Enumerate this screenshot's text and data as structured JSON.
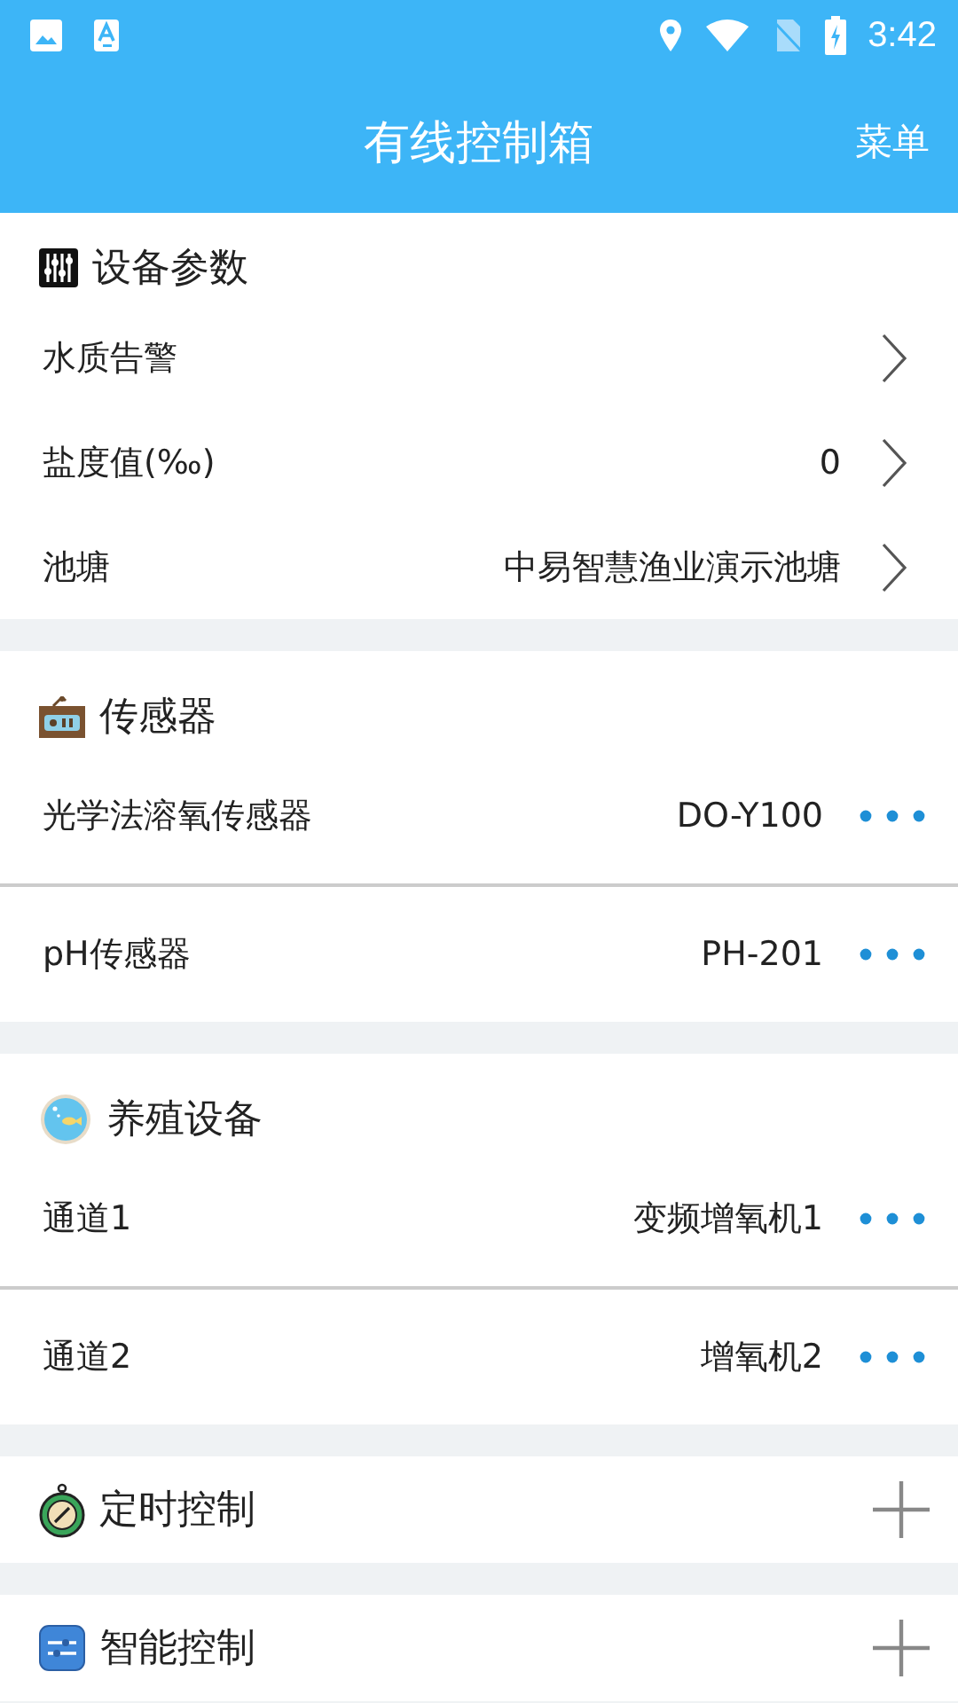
{
  "status_bar": {
    "time": "3:42"
  },
  "app_bar": {
    "title": "有线控制箱",
    "menu": "菜单"
  },
  "sections": [
    {
      "title": "设备参数",
      "kind": "list",
      "items": [
        {
          "kind": "chevron",
          "label": "水质告警"
        },
        {
          "kind": "chevron",
          "label": "盐度值(‰)",
          "value": "0"
        },
        {
          "kind": "chevron",
          "label": "池塘",
          "value": "中易智慧渔业演示池塘"
        }
      ]
    },
    {
      "title": "传感器",
      "kind": "list",
      "items": [
        {
          "kind": "more",
          "label": "光学法溶氧传感器",
          "value": "DO-Y100"
        },
        {
          "kind": "more",
          "label": "pH传感器",
          "value": "PH-201"
        }
      ]
    },
    {
      "title": "养殖设备",
      "kind": "list",
      "items": [
        {
          "kind": "more",
          "label": "通道1",
          "value": "变频增氧机1"
        },
        {
          "kind": "more",
          "label": "通道2",
          "value": "增氧机2"
        }
      ]
    },
    {
      "title": "定时控制",
      "kind": "add"
    },
    {
      "title": "智能控制",
      "kind": "add"
    }
  ]
}
